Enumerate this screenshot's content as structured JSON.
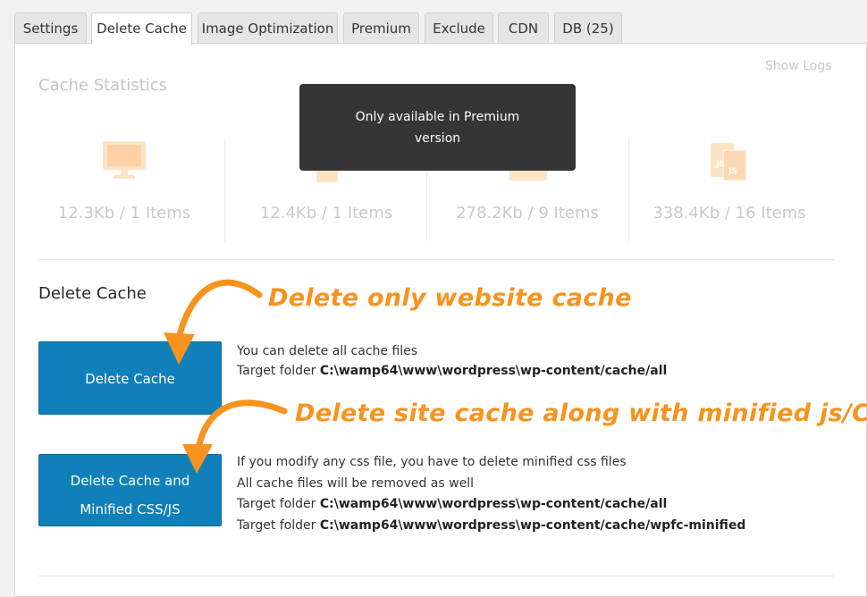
{
  "tabs": [
    {
      "label": "Settings",
      "active": false
    },
    {
      "label": "Delete Cache",
      "active": true
    },
    {
      "label": "Image Optimization",
      "active": false
    },
    {
      "label": "Premium",
      "active": false
    },
    {
      "label": "Exclude",
      "active": false
    },
    {
      "label": "CDN",
      "active": false
    },
    {
      "label": "DB (25)",
      "active": false
    }
  ],
  "header": {
    "show_logs": "Show Logs",
    "stats_title": "Cache Statistics"
  },
  "stats": [
    {
      "icon": "desktop-icon",
      "value": "12.3Kb / 1 Items"
    },
    {
      "icon": "mobile-icon",
      "value": "12.4Kb / 1 Items"
    },
    {
      "icon": "image-icon",
      "value": "278.2Kb / 9 Items"
    },
    {
      "icon": "js-css-file-icon",
      "value": "338.4Kb / 16 Items"
    }
  ],
  "tooltip": {
    "line1": "Only available in Premium",
    "line2": "version"
  },
  "delete_section": {
    "title": "Delete Cache",
    "button1": "Delete Cache",
    "button2_line1": "Delete Cache and",
    "button2_line2": "Minified CSS/JS",
    "desc1_line1": "You can delete all cache files",
    "desc1_target_label": "Target folder",
    "desc1_target_path": "C:\\wamp64\\www\\wordpress\\wp-content/cache/all",
    "desc2_line1": "If you modify any css file, you have to delete minified css files",
    "desc2_line2": "All cache files will be removed as well",
    "desc2_target1_label": "Target folder",
    "desc2_target1_path": "C:\\wamp64\\www\\wordpress\\wp-content/cache/all",
    "desc2_target2_label": "Target folder",
    "desc2_target2_path": "C:\\wamp64\\www\\wordpress\\wp-content/cache/wpfc-minified"
  },
  "annotations": {
    "note1": "Delete only website cache",
    "note2": "Delete site cache along with minified js/CSS"
  },
  "colors": {
    "accent_orange": "#f7931e",
    "button_blue": "#0f80b9",
    "icon_faded": "#fde3c6"
  }
}
